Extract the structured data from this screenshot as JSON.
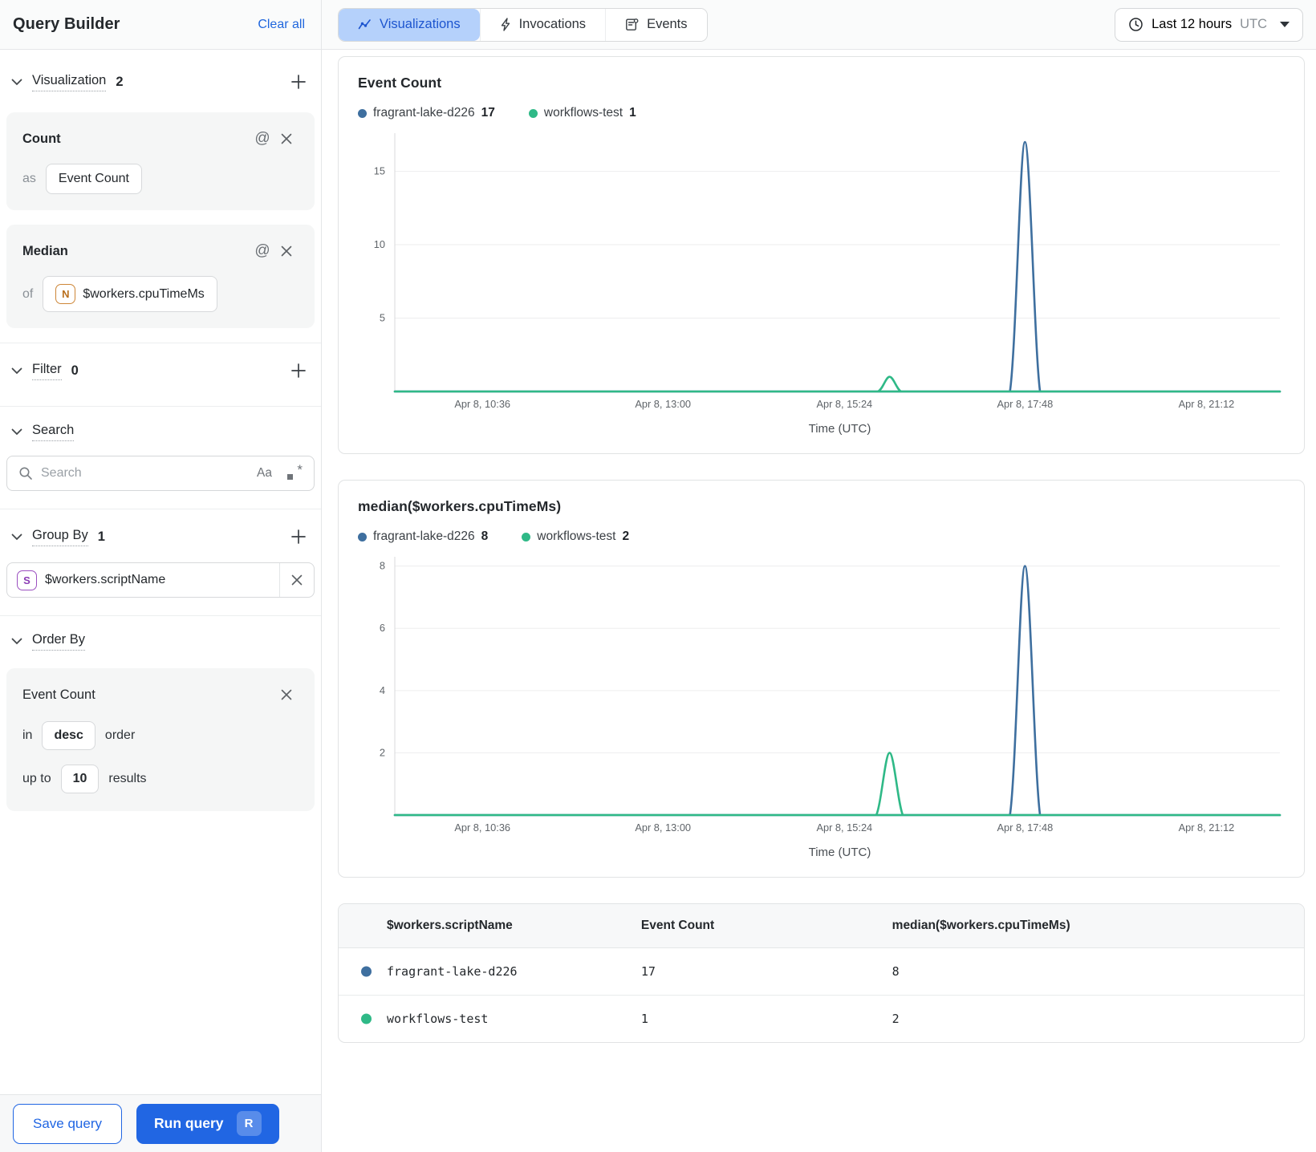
{
  "colors": {
    "accent_blue": "#2166e3",
    "tab_active_bg": "#b5d1fb",
    "tab_active_text": "#1d55cf",
    "series_blue": "#3e6f9f",
    "series_green": "#2fb987",
    "numeric_badge_orange": "#c87a28",
    "string_badge_purple": "#9b4fc0"
  },
  "sidebar": {
    "title": "Query Builder",
    "clear_all": "Clear all",
    "sections": {
      "visualization": {
        "label": "Visualization",
        "count": "2"
      },
      "filter": {
        "label": "Filter",
        "count": "0"
      },
      "search": {
        "label": "Search"
      },
      "group_by": {
        "label": "Group By",
        "count": "1"
      },
      "order_by": {
        "label": "Order By"
      }
    },
    "visualizations": [
      {
        "title": "Count",
        "prefix": "as",
        "value": "Event Count"
      },
      {
        "title": "Median",
        "prefix": "of",
        "type_badge": "N",
        "value": "$workers.cpuTimeMs"
      }
    ],
    "search": {
      "placeholder": "Search",
      "case_icon": "Aa"
    },
    "group_by_items": [
      {
        "type_badge": "S",
        "value": "$workers.scriptName"
      }
    ],
    "order_by": {
      "field": "Event Count",
      "in_label": "in",
      "direction": "desc",
      "order_label": "order",
      "up_to_label": "up to",
      "limit": "10",
      "results_label": "results"
    },
    "footer": {
      "save_label": "Save query",
      "run_label": "Run query",
      "run_shortcut": "R"
    }
  },
  "header": {
    "tabs": [
      {
        "label": "Visualizations",
        "active": true
      },
      {
        "label": "Invocations",
        "active": false
      },
      {
        "label": "Events",
        "active": false
      }
    ],
    "time_range": {
      "label": "Last 12 hours",
      "timezone": "UTC"
    }
  },
  "chart_data": [
    {
      "type": "line",
      "title": "Event Count",
      "xlabel": "Time (UTC)",
      "grid": true,
      "legend_position": "top",
      "ylim": [
        0,
        17.6
      ],
      "y_ticks": [
        5,
        10,
        15
      ],
      "x_ticks": [
        {
          "label": "Apr 8, 10:36",
          "pos": 0.099
        },
        {
          "label": "Apr 8, 13:00",
          "pos": 0.303
        },
        {
          "label": "Apr 8, 15:24",
          "pos": 0.508
        },
        {
          "label": "Apr 8, 17:48",
          "pos": 0.712
        },
        {
          "label": "Apr 8, 21:12",
          "pos": 0.917
        }
      ],
      "series": [
        {
          "name": "fragrant-lake-d226",
          "total": 17,
          "color": "#3e6f9f",
          "points": [
            [
              0,
              0
            ],
            [
              0.67,
              0
            ],
            [
              0.695,
              0
            ],
            [
              0.712,
              17
            ],
            [
              0.729,
              0
            ],
            [
              0.75,
              0
            ],
            [
              1,
              0
            ]
          ]
        },
        {
          "name": "workflows-test",
          "total": 1,
          "color": "#2fb987",
          "points": [
            [
              0,
              0
            ],
            [
              0.525,
              0
            ],
            [
              0.546,
              0
            ],
            [
              0.559,
              1
            ],
            [
              0.572,
              0
            ],
            [
              0.59,
              0
            ],
            [
              1,
              0
            ]
          ]
        }
      ]
    },
    {
      "type": "line",
      "title": "median($workers.cpuTimeMs)",
      "xlabel": "Time (UTC)",
      "grid": true,
      "legend_position": "top",
      "ylim": [
        0,
        8.3
      ],
      "y_ticks": [
        2,
        4,
        6,
        8
      ],
      "x_ticks": [
        {
          "label": "Apr 8, 10:36",
          "pos": 0.099
        },
        {
          "label": "Apr 8, 13:00",
          "pos": 0.303
        },
        {
          "label": "Apr 8, 15:24",
          "pos": 0.508
        },
        {
          "label": "Apr 8, 17:48",
          "pos": 0.712
        },
        {
          "label": "Apr 8, 21:12",
          "pos": 0.917
        }
      ],
      "series": [
        {
          "name": "fragrant-lake-d226",
          "total": 8,
          "color": "#3e6f9f",
          "points": [
            [
              0,
              0
            ],
            [
              0.67,
              0
            ],
            [
              0.695,
              0
            ],
            [
              0.712,
              8
            ],
            [
              0.729,
              0
            ],
            [
              0.75,
              0
            ],
            [
              1,
              0
            ]
          ]
        },
        {
          "name": "workflows-test",
          "total": 2,
          "color": "#2fb987",
          "points": [
            [
              0,
              0
            ],
            [
              0.525,
              0
            ],
            [
              0.544,
              0
            ],
            [
              0.559,
              2
            ],
            [
              0.574,
              0
            ],
            [
              0.592,
              0
            ],
            [
              1,
              0
            ]
          ]
        }
      ]
    }
  ],
  "table": {
    "columns": [
      "$workers.scriptName",
      "Event Count",
      "median($workers.cpuTimeMs)"
    ],
    "rows": [
      {
        "name": "fragrant-lake-d226",
        "color": "#3e6f9f",
        "event_count": "17",
        "median": "8"
      },
      {
        "name": "workflows-test",
        "color": "#2fb987",
        "event_count": "1",
        "median": "2"
      }
    ]
  }
}
